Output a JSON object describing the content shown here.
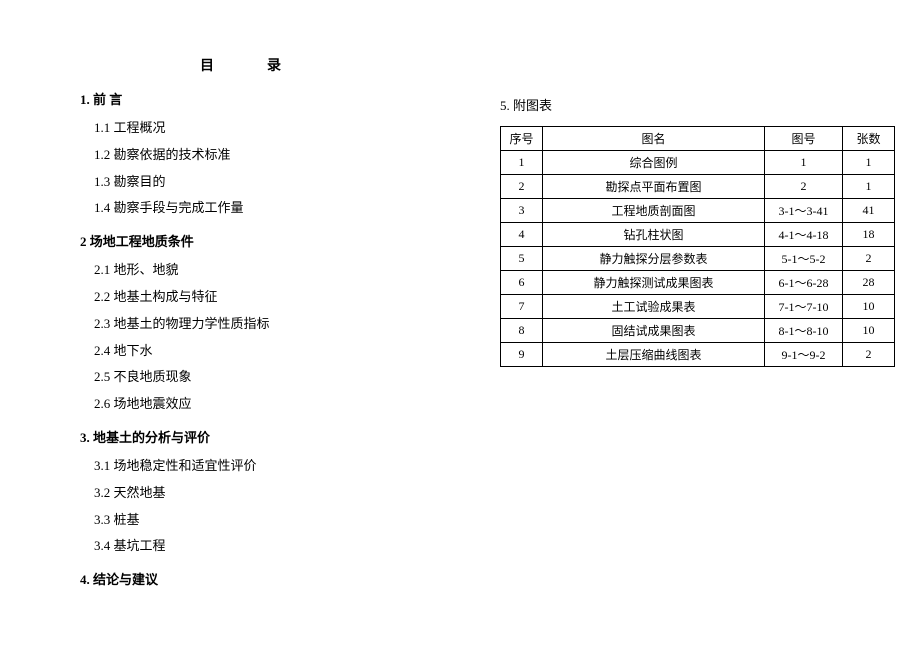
{
  "title": {
    "char1": "目",
    "char2": "录"
  },
  "sections": [
    {
      "heading": "1. 前 言",
      "items": [
        "1.1 工程概况",
        "1.2 勘察依据的技术标准",
        "1.3 勘察目的",
        "1.4 勘察手段与完成工作量"
      ]
    },
    {
      "heading": "2 场地工程地质条件",
      "items": [
        "2.1 地形、地貌",
        "2.2 地基土构成与特征",
        "2.3 地基土的物理力学性质指标",
        "2.4 地下水",
        "2.5 不良地质现象",
        "2.6 场地地震效应"
      ]
    },
    {
      "heading": "3. 地基土的分析与评价",
      "items": [
        "3.1 场地稳定性和适宜性评价",
        "3.2 天然地基",
        "3.3 桩基",
        "3.4 基坑工程"
      ]
    },
    {
      "heading": "4. 结论与建议",
      "items": []
    }
  ],
  "appendix": {
    "heading": "5. 附图表",
    "headers": {
      "seq": "序号",
      "name": "图名",
      "num": "图号",
      "count": "张数"
    },
    "rows": [
      {
        "seq": "1",
        "name": "综合图例",
        "num": "1",
        "count": "1"
      },
      {
        "seq": "2",
        "name": "勘探点平面布置图",
        "num": "2",
        "count": "1"
      },
      {
        "seq": "3",
        "name": "工程地质剖面图",
        "num": "3-1～3-41",
        "count": "41"
      },
      {
        "seq": "4",
        "name": "钻孔柱状图",
        "num": "4-1～4-18",
        "count": "18"
      },
      {
        "seq": "5",
        "name": "静力触探分层参数表",
        "num": "5-1～5-2",
        "count": "2"
      },
      {
        "seq": "6",
        "name": "静力触探测试成果图表",
        "num": "6-1～6-28",
        "count": "28"
      },
      {
        "seq": "7",
        "name": "土工试验成果表",
        "num": "7-1～7-10",
        "count": "10"
      },
      {
        "seq": "8",
        "name": "固结试成果图表",
        "num": "8-1～8-10",
        "count": "10"
      },
      {
        "seq": "9",
        "name": "土层压缩曲线图表",
        "num": "9-1～9-2",
        "count": "2"
      }
    ]
  }
}
